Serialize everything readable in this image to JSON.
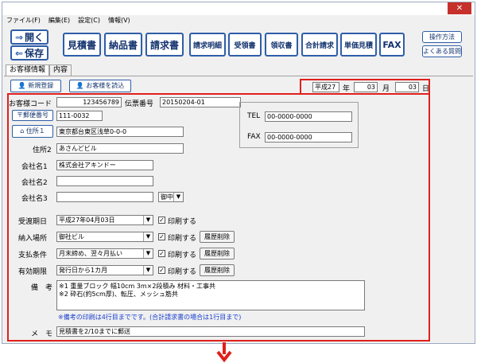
{
  "menu": [
    "ファイル(F)",
    "編集(E)",
    "設定(C)",
    "情報(V)"
  ],
  "toolbar": {
    "open": "開く",
    "save": "保存",
    "buttons": [
      "見積書",
      "納品書",
      "請求書",
      "請求明細",
      "受領書",
      "領収書",
      "合計請求",
      "単価見積",
      "FAX"
    ],
    "help": [
      "操作方法",
      "よくある質問"
    ]
  },
  "tabs": [
    "お客様情報",
    "内容"
  ],
  "actions": {
    "new": "新規登録",
    "load": "お客様を読込"
  },
  "date": {
    "era": "平成27",
    "year_unit": "年",
    "month": "03",
    "month_unit": "月",
    "day": "03",
    "day_unit": "日"
  },
  "form": {
    "customer_code_label": "お客様コード",
    "customer_code": "123456789",
    "slip_label": "伝票番号",
    "slip": "20150204-01",
    "postal_btn": "郵便番号",
    "postal": "111-0032",
    "addr1_btn": "住所１",
    "addr1": "東京都台東区浅草0-0-0",
    "addr2_label": "住所2",
    "addr2": "あさんどビル",
    "company1_label": "会社名1",
    "company1": "株式会社アキンドー",
    "company2_label": "会社名2",
    "company2": "",
    "company3_label": "会社名3",
    "company3": "",
    "honorific": "御中",
    "tel_label": "TEL",
    "tel": "00-0000-0000",
    "fax_label": "FAX",
    "fax": "00-0000-0000",
    "rows": [
      {
        "label": "受渡期日",
        "value": "平成27年04月03日",
        "print": "印刷する",
        "reset": ""
      },
      {
        "label": "納入場所",
        "value": "御社ビル",
        "print": "印刷する",
        "reset": "履歴削除"
      },
      {
        "label": "支払条件",
        "value": "月末締め、翌々月払い",
        "print": "印刷する",
        "reset": "履歴削除"
      },
      {
        "label": "有効期限",
        "value": "発行日から1カ月",
        "print": "印刷する",
        "reset": "履歴削除"
      }
    ],
    "remarks_label": "備　考",
    "remarks_line1": "※1 重量ブロック 幅10cm 3m×2段積み 材料・工事共",
    "remarks_line2": "※2 砕石(約5cm厚)、転圧、メッシュ筋共",
    "remarks_note": "※備考の印刷は4行目までです。(合計請求書の場合は1行目まで)",
    "memo_label": "メ　モ",
    "memo": "見積書を2/10までに郵送"
  },
  "colors": {
    "accent": "#2f5ea8",
    "highlight_border": "#e0201c",
    "note": "#1a3fd0"
  }
}
